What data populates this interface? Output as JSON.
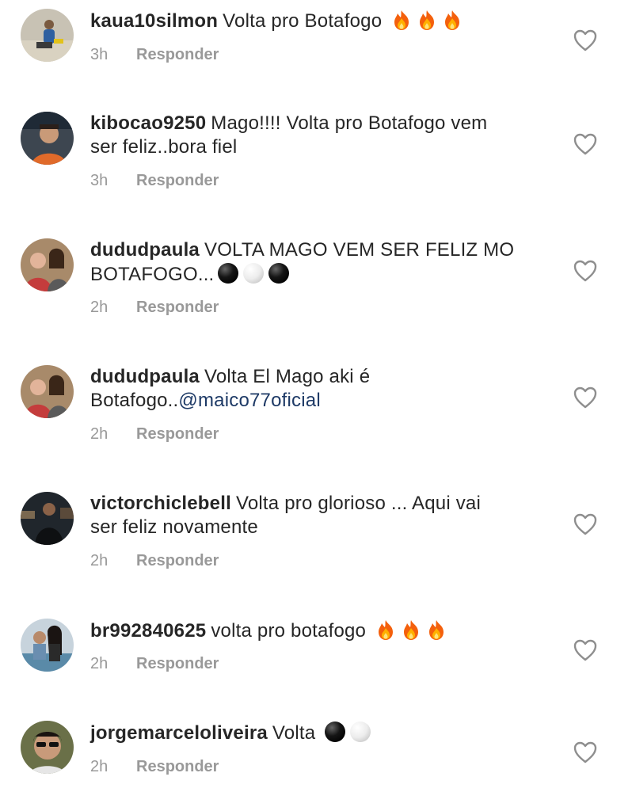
{
  "comments": [
    {
      "username": "kaua10silmon",
      "text": "Volta pro Botafogo",
      "time": "3h",
      "reply_label": "Responder"
    },
    {
      "username": "kibocao9250",
      "text_line1": "Mago!!!! Volta pro Botafogo vem",
      "text_line2": "ser feliz..bora fiel",
      "time": "3h",
      "reply_label": "Responder"
    },
    {
      "username": "dududpaula",
      "text_line1": "VOLTA MAGO VEM SER FELIZ MO",
      "text_line2": "BOTAFOGO...",
      "time": "2h",
      "reply_label": "Responder"
    },
    {
      "username": "dududpaula",
      "text_line1": "Volta El Mago aki é",
      "text_line2": "Botafogo..",
      "mention": "@maico77oficial",
      "time": "2h",
      "reply_label": "Responder"
    },
    {
      "username": "victorchiclebell",
      "text_line1": "Volta pro glorioso ... Aqui vai",
      "text_line2": "ser feliz novamente",
      "time": "2h",
      "reply_label": "Responder"
    },
    {
      "username": "br992840625",
      "text": "volta pro botafogo",
      "time": "2h",
      "reply_label": "Responder"
    },
    {
      "username": "jorgemarceloliveira",
      "text": "Volta",
      "time": "2h",
      "reply_label": "Responder"
    }
  ],
  "icons": {
    "like": "heart-outline-icon",
    "fire": "fire-emoji",
    "black_circle": "black-circle-emoji",
    "white_circle": "white-circle-emoji"
  },
  "colors": {
    "text": "#262626",
    "meta": "#999999",
    "mention": "#1e3a66"
  }
}
